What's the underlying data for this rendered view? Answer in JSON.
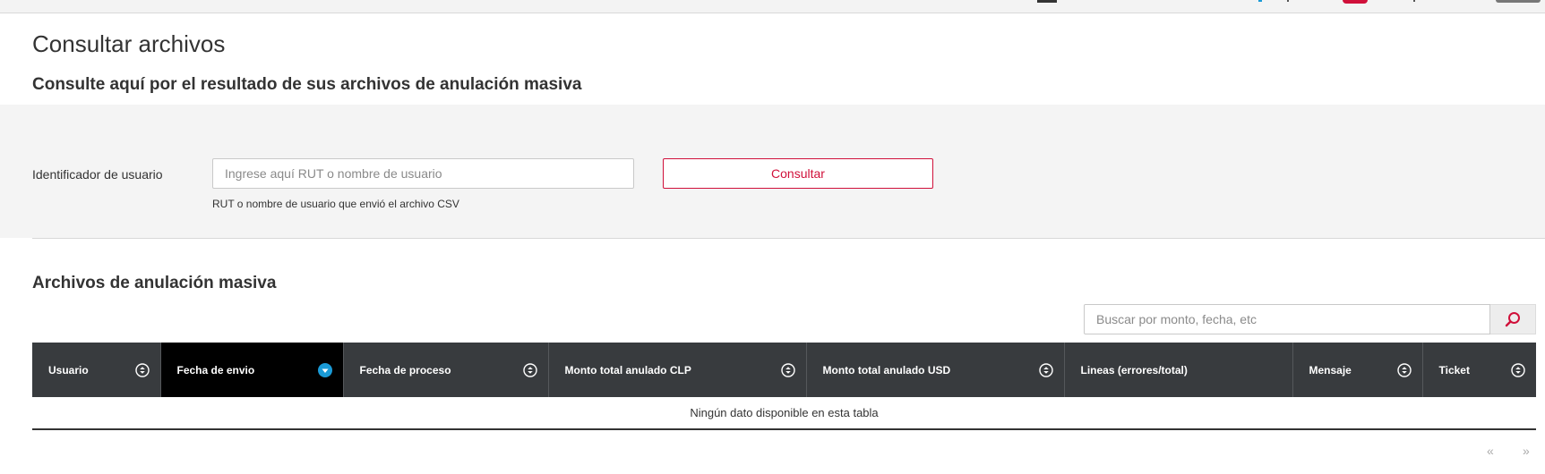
{
  "page": {
    "title": "Consultar archivos",
    "subtitle": "Consulte aquí por el resultado de sus archivos de anulación masiva"
  },
  "filter": {
    "label": "Identificador de usuario",
    "input_placeholder": "Ingrese aquí RUT o nombre de usuario",
    "input_value": "",
    "help_text": "RUT o nombre de usuario que envió el archivo CSV",
    "button_label": "Consultar"
  },
  "section": {
    "title": "Archivos de anulación masiva"
  },
  "search": {
    "placeholder": "Buscar por monto, fecha, etc",
    "value": "",
    "icon": "search-icon"
  },
  "table": {
    "columns": [
      {
        "label": "Usuario",
        "sort": "unsorted"
      },
      {
        "label": "Fecha de envio",
        "sort": "descending"
      },
      {
        "label": "Fecha de proceso",
        "sort": "unsorted"
      },
      {
        "label": "Monto total anulado CLP",
        "sort": "unsorted"
      },
      {
        "label": "Monto total anulado USD",
        "sort": "unsorted"
      },
      {
        "label": "Lineas (errores/total)",
        "sort": "none"
      },
      {
        "label": "Mensaje",
        "sort": "unsorted"
      },
      {
        "label": "Ticket",
        "sort": "unsorted"
      }
    ],
    "empty_message": "Ningún dato disponible en esta tabla"
  },
  "pagination": {
    "prev_label": "«",
    "next_label": "»"
  },
  "colors": {
    "accent": "#d0103a",
    "header_bg": "#383b3e",
    "active_header_bg": "#000000",
    "sort_active": "#1a9ad6"
  }
}
